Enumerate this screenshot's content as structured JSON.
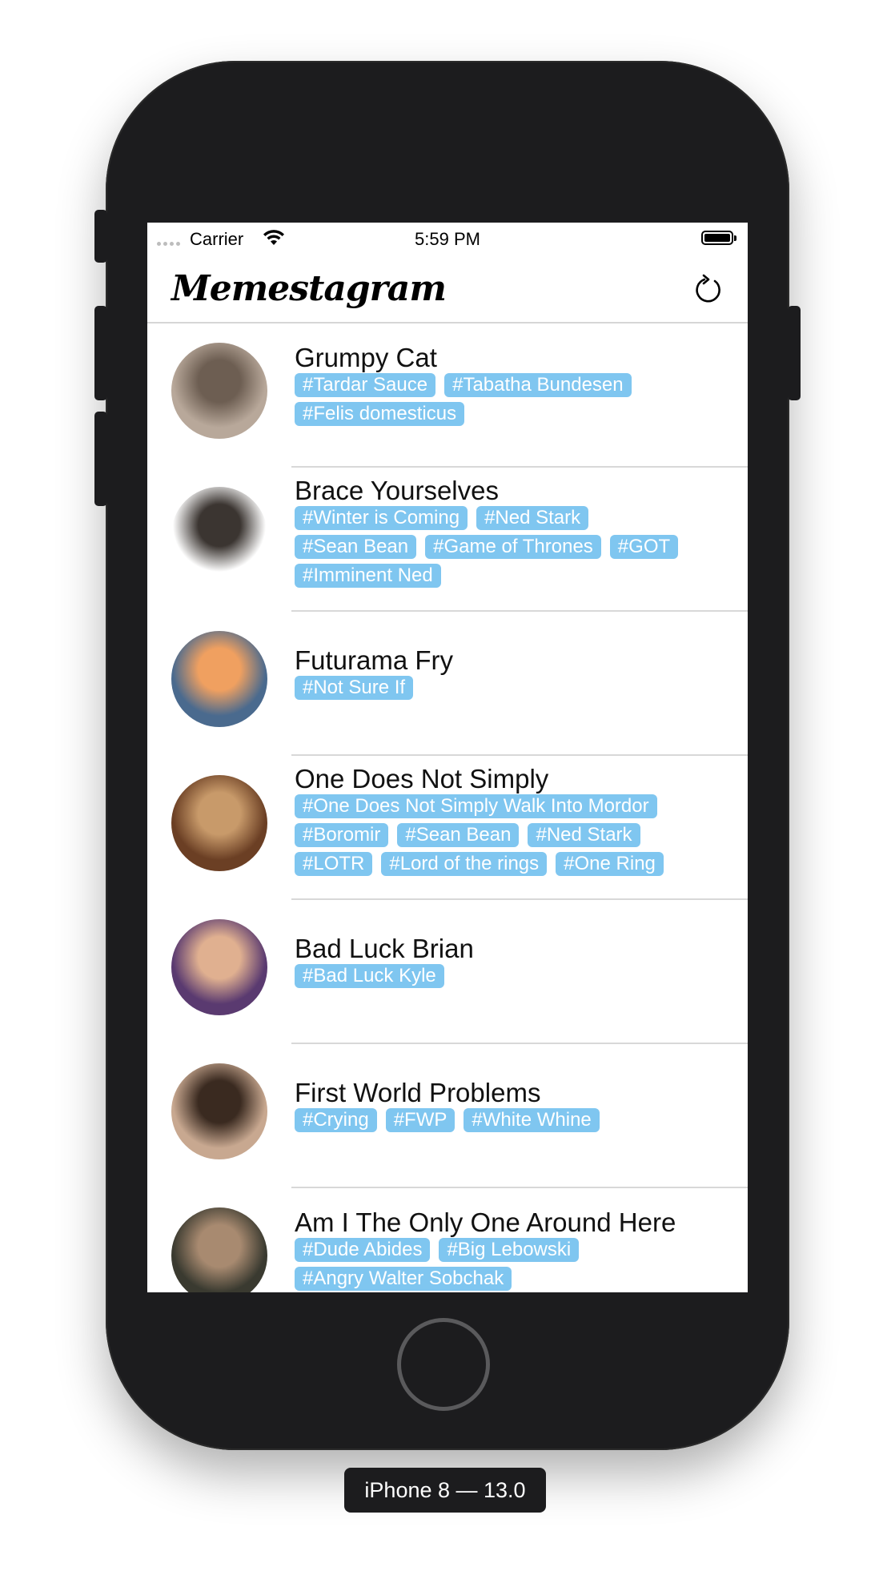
{
  "status_bar": {
    "carrier": "Carrier",
    "time": "5:59 PM"
  },
  "nav": {
    "app_title": "Memestagram",
    "refresh_icon": "refresh-icon"
  },
  "memes": [
    {
      "title": "Grumpy Cat",
      "avatar_colors": [
        "#b8a89a",
        "#6d5e52"
      ],
      "tags": [
        "#Tardar Sauce",
        "#Tabatha Bundesen",
        "#Felis domesticus"
      ]
    },
    {
      "title": "Brace Yourselves",
      "avatar_colors": [
        "#ffffff",
        "#3b3531"
      ],
      "tags": [
        "#Winter is Coming",
        "#Ned Stark",
        "#Sean Bean",
        "#Game of Thrones",
        "#GOT",
        "#Imminent Ned"
      ]
    },
    {
      "title": "Futurama Fry",
      "avatar_colors": [
        "#4a6a8e",
        "#f0a060"
      ],
      "tags": [
        "#Not Sure If"
      ]
    },
    {
      "title": "One Does Not Simply",
      "avatar_colors": [
        "#6b3f24",
        "#c89a6a"
      ],
      "tags": [
        "#One Does Not Simply Walk Into Mordor",
        "#Boromir",
        "#Sean Bean",
        "#Ned Stark",
        "#LOTR",
        "#Lord of the rings",
        "#One Ring"
      ]
    },
    {
      "title": "Bad Luck Brian",
      "avatar_colors": [
        "#5a3a70",
        "#e0b090"
      ],
      "tags": [
        "#Bad Luck Kyle"
      ]
    },
    {
      "title": "First World Problems",
      "avatar_colors": [
        "#c8a890",
        "#3a2a20"
      ],
      "tags": [
        "#Crying",
        "#FWP",
        "#White Whine"
      ]
    },
    {
      "title": "Am I The Only One Around Here",
      "avatar_colors": [
        "#3a3a30",
        "#a88a70"
      ],
      "tags": [
        "#Dude Abides",
        "#Big Lebowski",
        "#Angry Walter Sobchak"
      ]
    }
  ],
  "device": {
    "label": "iPhone 8 — 13.0"
  },
  "colors": {
    "tag_bg": "#7fc6f0",
    "phone_body": "#1c1c1e"
  }
}
